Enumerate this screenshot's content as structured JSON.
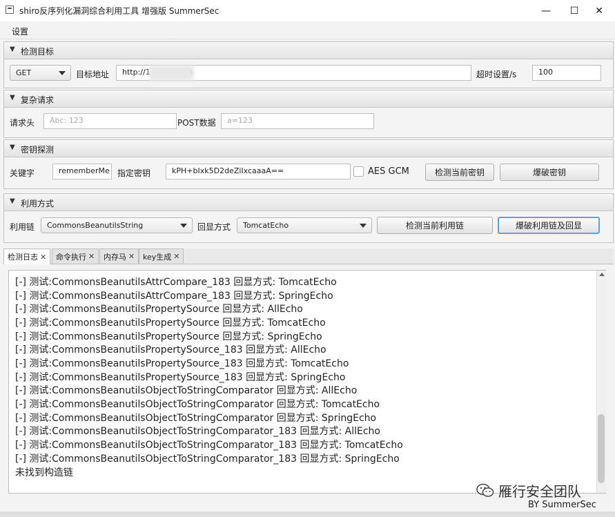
{
  "window": {
    "title": "shiro反序列化漏洞综合利用工具 增强版 SummerSec",
    "min": "—",
    "max": "☐",
    "close": "✕"
  },
  "menu": {
    "settings": "设置"
  },
  "detect": {
    "header": "检测目标",
    "method": "GET",
    "target_label": "目标地址",
    "target_value": "http://1            88/dologin",
    "timeout_label": "超时设置/s",
    "timeout_value": "100"
  },
  "complex": {
    "header": "复杂请求",
    "headers_label": "请求头",
    "headers_placeholder": "Abc: 123",
    "post_label": "POST数据",
    "post_placeholder": "a=123"
  },
  "key": {
    "header": "密钥探测",
    "keyword_label": "关键字",
    "keyword_value": "rememberMe",
    "specify_label": "指定密钥",
    "key_value": "kPH+bIxk5D2deZiIxcaaaA==",
    "aes_label": "AES GCM",
    "check_key_btn": "检测当前密钥",
    "brute_key_btn": "爆破密钥"
  },
  "exploit": {
    "header": "利用方式",
    "chain_label": "利用链",
    "chain_value": "CommonsBeanutilsString",
    "echo_label": "回显方式",
    "echo_value": "TomcatEcho",
    "check_chain_btn": "检测当前利用链",
    "brute_chain_btn": "爆破利用链及回显"
  },
  "tabs": [
    "检测日志",
    "命令执行",
    "内存马",
    "key生成"
  ],
  "log": [
    "[-] 测试:CommonsBeanutilsAttrCompare_183  回显方式: TomcatEcho",
    "[-] 测试:CommonsBeanutilsAttrCompare_183  回显方式: SpringEcho",
    "[-] 测试:CommonsBeanutilsPropertySource  回显方式: AllEcho",
    "[-] 测试:CommonsBeanutilsPropertySource  回显方式: TomcatEcho",
    "[-] 测试:CommonsBeanutilsPropertySource  回显方式: SpringEcho",
    "[-] 测试:CommonsBeanutilsPropertySource_183  回显方式: AllEcho",
    "[-] 测试:CommonsBeanutilsPropertySource_183  回显方式: TomcatEcho",
    "[-] 测试:CommonsBeanutilsPropertySource_183  回显方式: SpringEcho",
    "[-] 测试:CommonsBeanutilsObjectToStringComparator  回显方式: AllEcho",
    "[-] 测试:CommonsBeanutilsObjectToStringComparator  回显方式: TomcatEcho",
    "[-] 测试:CommonsBeanutilsObjectToStringComparator  回显方式: SpringEcho",
    "[-] 测试:CommonsBeanutilsObjectToStringComparator_183  回显方式: AllEcho",
    "[-] 测试:CommonsBeanutilsObjectToStringComparator_183  回显方式: TomcatEcho",
    "[-] 测试:CommonsBeanutilsObjectToStringComparator_183  回显方式: SpringEcho",
    "未找到构造链"
  ],
  "watermark": {
    "text": "雁行安全团队",
    "by": "BY  SummerSec",
    "icon": "wechat-icon"
  }
}
